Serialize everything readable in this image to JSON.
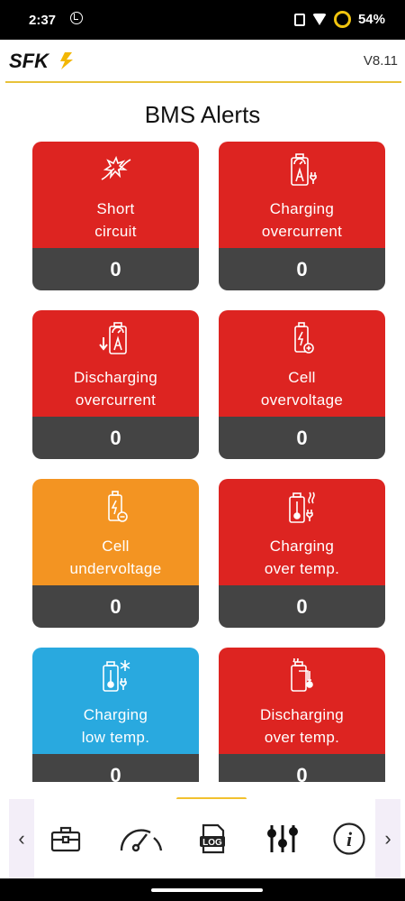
{
  "status": {
    "time": "2:37",
    "battery": "54%"
  },
  "header": {
    "logo_text": "SFK",
    "version": "V8.11"
  },
  "page": {
    "title": "BMS Alerts"
  },
  "alerts": [
    {
      "line1": "Short",
      "line2": "circuit",
      "count": "0",
      "color": "#dd2421",
      "icon": "short-circuit-icon"
    },
    {
      "line1": "Charging",
      "line2": "overcurrent",
      "count": "0",
      "color": "#dd2421",
      "icon": "battery-charging-current-icon"
    },
    {
      "line1": "Discharging",
      "line2": "overcurrent",
      "count": "0",
      "color": "#dd2421",
      "icon": "battery-discharging-current-icon"
    },
    {
      "line1": "Cell",
      "line2": "overvoltage",
      "count": "0",
      "color": "#dd2421",
      "icon": "cell-overvoltage-icon"
    },
    {
      "line1": "Cell",
      "line2": "undervoltage",
      "count": "0",
      "color": "#f39422",
      "icon": "cell-undervoltage-icon"
    },
    {
      "line1": "Charging",
      "line2": "over temp.",
      "count": "0",
      "color": "#dd2421",
      "icon": "charging-over-temp-icon"
    },
    {
      "line1": "Charging",
      "line2": "low temp.",
      "count": "0",
      "color": "#29a9df",
      "icon": "charging-low-temp-icon"
    },
    {
      "line1": "Discharging",
      "line2": "over temp.",
      "count": "0",
      "color": "#dd2421",
      "icon": "discharging-over-temp-icon"
    }
  ],
  "nav": {
    "items": [
      {
        "icon": "toolbox-icon"
      },
      {
        "icon": "gauge-icon"
      },
      {
        "icon": "log-icon",
        "label": "LOG",
        "active": true
      },
      {
        "icon": "sliders-icon"
      },
      {
        "icon": "info-icon",
        "label": "i"
      }
    ],
    "prev": "‹",
    "next": "›"
  }
}
